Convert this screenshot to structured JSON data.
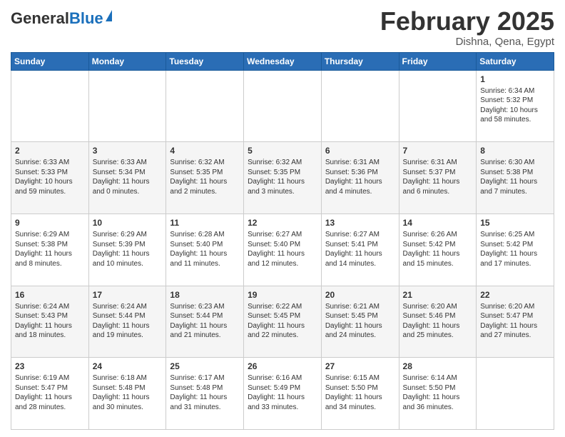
{
  "header": {
    "logo_general": "General",
    "logo_blue": "Blue",
    "month": "February 2025",
    "location": "Dishna, Qena, Egypt"
  },
  "days_of_week": [
    "Sunday",
    "Monday",
    "Tuesday",
    "Wednesday",
    "Thursday",
    "Friday",
    "Saturday"
  ],
  "weeks": [
    [
      {
        "num": "",
        "info": ""
      },
      {
        "num": "",
        "info": ""
      },
      {
        "num": "",
        "info": ""
      },
      {
        "num": "",
        "info": ""
      },
      {
        "num": "",
        "info": ""
      },
      {
        "num": "",
        "info": ""
      },
      {
        "num": "1",
        "info": "Sunrise: 6:34 AM\nSunset: 5:32 PM\nDaylight: 10 hours and 58 minutes."
      }
    ],
    [
      {
        "num": "2",
        "info": "Sunrise: 6:33 AM\nSunset: 5:33 PM\nDaylight: 10 hours and 59 minutes."
      },
      {
        "num": "3",
        "info": "Sunrise: 6:33 AM\nSunset: 5:34 PM\nDaylight: 11 hours and 0 minutes."
      },
      {
        "num": "4",
        "info": "Sunrise: 6:32 AM\nSunset: 5:35 PM\nDaylight: 11 hours and 2 minutes."
      },
      {
        "num": "5",
        "info": "Sunrise: 6:32 AM\nSunset: 5:35 PM\nDaylight: 11 hours and 3 minutes."
      },
      {
        "num": "6",
        "info": "Sunrise: 6:31 AM\nSunset: 5:36 PM\nDaylight: 11 hours and 4 minutes."
      },
      {
        "num": "7",
        "info": "Sunrise: 6:31 AM\nSunset: 5:37 PM\nDaylight: 11 hours and 6 minutes."
      },
      {
        "num": "8",
        "info": "Sunrise: 6:30 AM\nSunset: 5:38 PM\nDaylight: 11 hours and 7 minutes."
      }
    ],
    [
      {
        "num": "9",
        "info": "Sunrise: 6:29 AM\nSunset: 5:38 PM\nDaylight: 11 hours and 8 minutes."
      },
      {
        "num": "10",
        "info": "Sunrise: 6:29 AM\nSunset: 5:39 PM\nDaylight: 11 hours and 10 minutes."
      },
      {
        "num": "11",
        "info": "Sunrise: 6:28 AM\nSunset: 5:40 PM\nDaylight: 11 hours and 11 minutes."
      },
      {
        "num": "12",
        "info": "Sunrise: 6:27 AM\nSunset: 5:40 PM\nDaylight: 11 hours and 12 minutes."
      },
      {
        "num": "13",
        "info": "Sunrise: 6:27 AM\nSunset: 5:41 PM\nDaylight: 11 hours and 14 minutes."
      },
      {
        "num": "14",
        "info": "Sunrise: 6:26 AM\nSunset: 5:42 PM\nDaylight: 11 hours and 15 minutes."
      },
      {
        "num": "15",
        "info": "Sunrise: 6:25 AM\nSunset: 5:42 PM\nDaylight: 11 hours and 17 minutes."
      }
    ],
    [
      {
        "num": "16",
        "info": "Sunrise: 6:24 AM\nSunset: 5:43 PM\nDaylight: 11 hours and 18 minutes."
      },
      {
        "num": "17",
        "info": "Sunrise: 6:24 AM\nSunset: 5:44 PM\nDaylight: 11 hours and 19 minutes."
      },
      {
        "num": "18",
        "info": "Sunrise: 6:23 AM\nSunset: 5:44 PM\nDaylight: 11 hours and 21 minutes."
      },
      {
        "num": "19",
        "info": "Sunrise: 6:22 AM\nSunset: 5:45 PM\nDaylight: 11 hours and 22 minutes."
      },
      {
        "num": "20",
        "info": "Sunrise: 6:21 AM\nSunset: 5:45 PM\nDaylight: 11 hours and 24 minutes."
      },
      {
        "num": "21",
        "info": "Sunrise: 6:20 AM\nSunset: 5:46 PM\nDaylight: 11 hours and 25 minutes."
      },
      {
        "num": "22",
        "info": "Sunrise: 6:20 AM\nSunset: 5:47 PM\nDaylight: 11 hours and 27 minutes."
      }
    ],
    [
      {
        "num": "23",
        "info": "Sunrise: 6:19 AM\nSunset: 5:47 PM\nDaylight: 11 hours and 28 minutes."
      },
      {
        "num": "24",
        "info": "Sunrise: 6:18 AM\nSunset: 5:48 PM\nDaylight: 11 hours and 30 minutes."
      },
      {
        "num": "25",
        "info": "Sunrise: 6:17 AM\nSunset: 5:48 PM\nDaylight: 11 hours and 31 minutes."
      },
      {
        "num": "26",
        "info": "Sunrise: 6:16 AM\nSunset: 5:49 PM\nDaylight: 11 hours and 33 minutes."
      },
      {
        "num": "27",
        "info": "Sunrise: 6:15 AM\nSunset: 5:50 PM\nDaylight: 11 hours and 34 minutes."
      },
      {
        "num": "28",
        "info": "Sunrise: 6:14 AM\nSunset: 5:50 PM\nDaylight: 11 hours and 36 minutes."
      },
      {
        "num": "",
        "info": ""
      }
    ]
  ]
}
